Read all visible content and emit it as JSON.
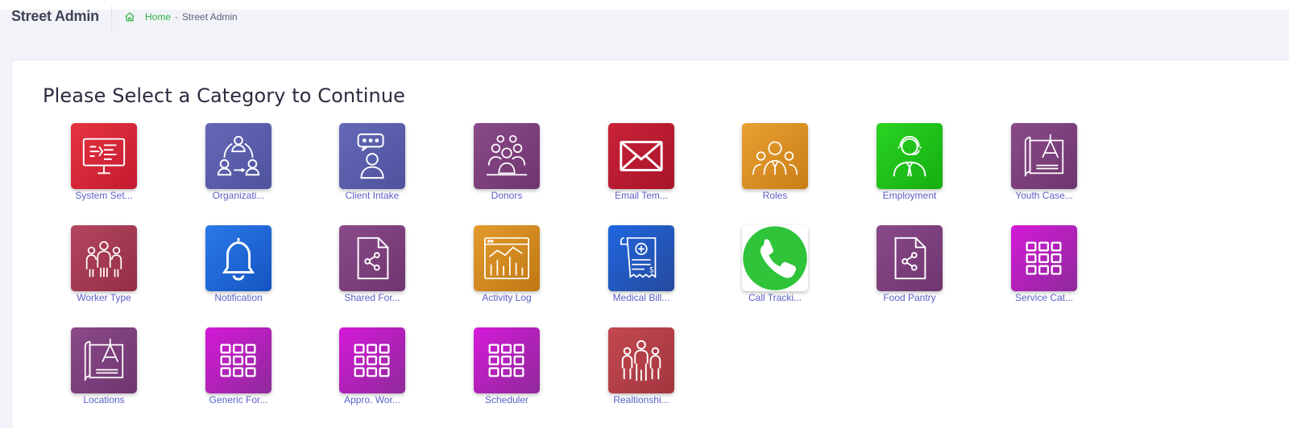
{
  "header": {
    "title": "Street Admin",
    "breadcrumb": {
      "home": "Home",
      "separator": "-",
      "current": "Street Admin"
    }
  },
  "main": {
    "heading": "Please Select a Category to Continue",
    "tiles": [
      {
        "label": "System Set...",
        "icon": "monitor-code-icon",
        "color": "#d8273a"
      },
      {
        "label": "Organizati...",
        "icon": "org-cycle-icon",
        "color": "#5a5ea8"
      },
      {
        "label": "Client Intake",
        "icon": "person-chat-icon",
        "color": "#5a5ea8"
      },
      {
        "label": "Donors",
        "icon": "group-people-icon",
        "color": "#7d3f7c"
      },
      {
        "label": "Email Tem...",
        "icon": "envelope-icon",
        "color": "#be1a2d"
      },
      {
        "label": "Roles",
        "icon": "roles-people-icon",
        "color": "#d98d1e"
      },
      {
        "label": "Employment",
        "icon": "employee-icon",
        "color": "#22c41a"
      },
      {
        "label": "Youth Case...",
        "icon": "blueprint-compass-icon",
        "color": "#7d3f7c"
      },
      {
        "label": "Worker Type",
        "icon": "workers-icon",
        "color": "#a83650"
      },
      {
        "label": "Notification",
        "icon": "bell-icon",
        "color": "#1e66d6"
      },
      {
        "label": "Shared For...",
        "icon": "shared-file-icon",
        "color": "#7d3f7c"
      },
      {
        "label": "Activity Log",
        "icon": "activity-chart-icon",
        "color": "#d98d1e"
      },
      {
        "label": "Medical Bill...",
        "icon": "medical-bill-icon",
        "color": "#1e5bd0"
      },
      {
        "label": "Call Tracki...",
        "icon": "phone-icon",
        "color": "#ffffff"
      },
      {
        "label": "Food Pantry",
        "icon": "shared-file-icon",
        "color": "#7d3f7c"
      },
      {
        "label": "Service Cat...",
        "icon": "grid-icon",
        "color": "#c411c9"
      },
      {
        "label": "Locations",
        "icon": "blueprint-compass-icon",
        "color": "#7d3f7c"
      },
      {
        "label": "Generic For...",
        "icon": "grid-icon",
        "color": "#c411c9"
      },
      {
        "label": "Appro. Wor...",
        "icon": "grid-icon",
        "color": "#c411c9"
      },
      {
        "label": "Scheduler",
        "icon": "grid-icon",
        "color": "#c411c9"
      },
      {
        "label": "Realtionshi...",
        "icon": "relationship-people-icon",
        "color": "#b8434b"
      }
    ]
  }
}
